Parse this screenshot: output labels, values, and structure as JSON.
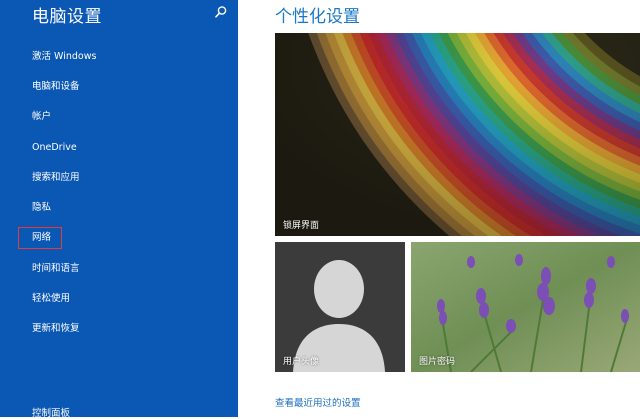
{
  "sidebar": {
    "title": "电脑设置",
    "search_icon": "search-icon",
    "items": [
      {
        "label": "激活 Windows"
      },
      {
        "label": "电脑和设备"
      },
      {
        "label": "帐户"
      },
      {
        "label": "OneDrive"
      },
      {
        "label": "搜索和应用"
      },
      {
        "label": "隐私"
      },
      {
        "label": "网络"
      },
      {
        "label": "时间和语言"
      },
      {
        "label": "轻松使用"
      },
      {
        "label": "更新和恢复"
      }
    ],
    "selected": "网络",
    "selected_outline_color": "#e23b3b",
    "footer_link": "控制面板",
    "background_color": "#0b57b4"
  },
  "main": {
    "title": "个性化设置",
    "title_color": "#1b78c7",
    "tiles": {
      "lock_screen": "锁屏界面",
      "avatar": "用户头像",
      "picture_password": "图片密码"
    },
    "recent_link": "查看最近用过的设置"
  }
}
